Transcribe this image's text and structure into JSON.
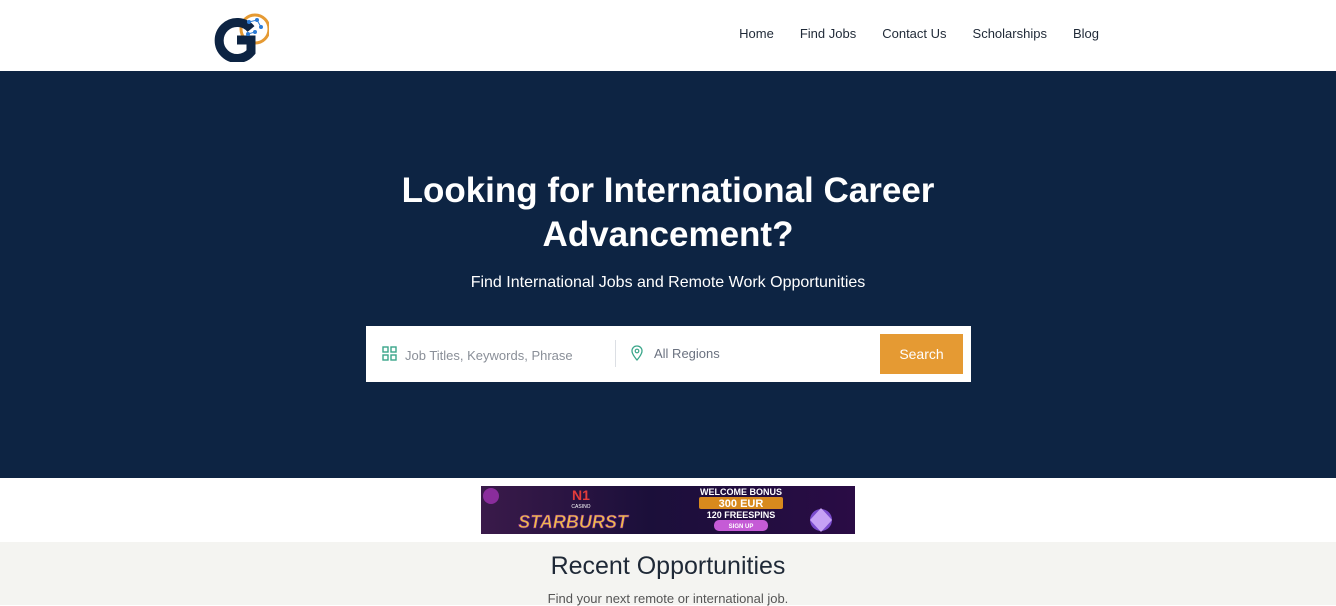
{
  "nav": {
    "items": [
      {
        "label": "Home"
      },
      {
        "label": "Find Jobs"
      },
      {
        "label": "Contact Us"
      },
      {
        "label": "Scholarships"
      },
      {
        "label": "Blog"
      }
    ]
  },
  "hero": {
    "title_line1": "Looking for International Career",
    "title_line2": "Advancement?",
    "subtitle": "Find International Jobs and Remote Work Opportunities"
  },
  "search": {
    "keyword_placeholder": "Job Titles, Keywords, Phrase",
    "region_value": "All Regions",
    "button_label": "Search"
  },
  "banner": {
    "brand": "N1",
    "brand_sub": "CASINO",
    "game": "STARBURST",
    "headline": "WELCOME BONUS",
    "amount": "300 EUR",
    "spins": "120 FREESPINS",
    "cta": "SIGN UP"
  },
  "recent": {
    "title": "Recent Opportunities",
    "subtitle": "Find your next remote or international job."
  },
  "colors": {
    "hero_bg": "#0d2443",
    "accent": "#e59a33",
    "recent_bg": "#f4f4f1"
  }
}
